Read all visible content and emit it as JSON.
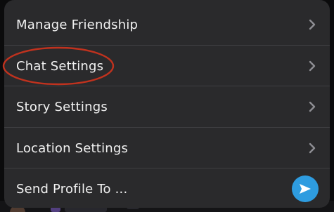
{
  "menu": {
    "items": [
      {
        "label": "Manage Friendship",
        "icon": "chevron-right-icon"
      },
      {
        "label": "Chat Settings",
        "icon": "chevron-right-icon"
      },
      {
        "label": "Story Settings",
        "icon": "chevron-right-icon"
      },
      {
        "label": "Location Settings",
        "icon": "chevron-right-icon"
      },
      {
        "label": "Send Profile To ...",
        "icon": "send-arrow-icon"
      }
    ]
  },
  "colors": {
    "sheet_bg": "#2a2a2c",
    "text": "#f2f2f2",
    "chevron": "#8e8e93",
    "send_button": "#2e9ce0",
    "highlight_ring": "#c0321e"
  }
}
